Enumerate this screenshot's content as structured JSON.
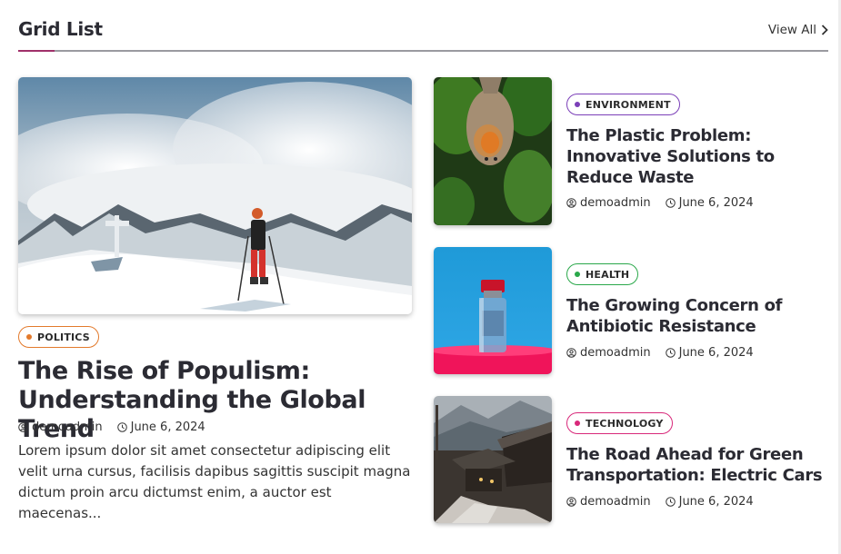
{
  "section": {
    "title": "Grid List",
    "view_all": "View All"
  },
  "featured": {
    "category": "POLITICS",
    "category_color": "#e37a2c",
    "title": "The Rise of Populism: Understanding the Global Trend",
    "author": "demoadmin",
    "date": "June 6, 2024",
    "excerpt": "Lorem ipsum dolor sit amet consectetur adipiscing elit velit urna cursus, facilisis dapibus sagittis suscipit magna dictum proin arcu dictumst enim, a auctor est maecenas..."
  },
  "cards": [
    {
      "category": "ENVIRONMENT",
      "category_color": "#7b3fb8",
      "title": "The Plastic Problem: Innovative Solutions to Reduce Waste",
      "author": "demoadmin",
      "date": "June 6, 2024"
    },
    {
      "category": "HEALTH",
      "category_color": "#2aa84a",
      "title": "The Growing Concern of Antibiotic Resistance",
      "author": "demoadmin",
      "date": "June 6, 2024"
    },
    {
      "category": "TECHNOLOGY",
      "category_color": "#d8287a",
      "title": "The Road Ahead for Green Transportation: Electric Cars",
      "author": "demoadmin",
      "date": "June 6, 2024"
    }
  ]
}
